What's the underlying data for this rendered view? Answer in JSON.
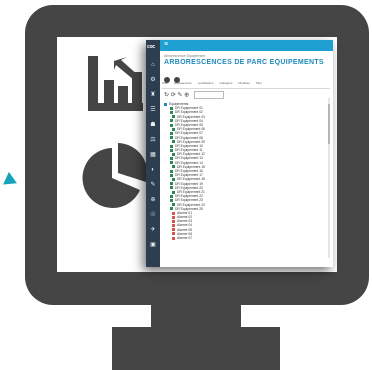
{
  "colors": {
    "monitor": "#454545",
    "accent": "#16a5b8",
    "app_header": "#1fa0d3",
    "app_sidebar": "#2c3e50"
  },
  "icons": [
    "bar-chart-growth-icon",
    "pie-chart-icon",
    "arrow-hint-icon"
  ],
  "app": {
    "logo": "coc",
    "menu_icon": "≡",
    "breadcrumb": "Arborescence Equipement",
    "title": "ARBORESCENCES DE PARC EQUIPEMENTS",
    "sidebar_icons": [
      "⌂",
      "⚙",
      "♜",
      "☰",
      "☗",
      "⚖",
      "▦",
      "◐",
      "✎",
      "⊕",
      "☉",
      "✈",
      "▣"
    ],
    "tabs": [
      "Parc",
      "Equipements",
      "Localisation",
      "Catégorie",
      "Modèles",
      "Plus"
    ],
    "toolbar_icons": "↻ ⟳ ✎ ⊕",
    "tree_rows": [
      "Equipements",
      "DR Equipement 01",
      "DR Equipement 02",
      "DR Equipement 03",
      "DR Equipement 04",
      "DR Equipement 05",
      "DR Equipement 06",
      "DR Equipement 07",
      "DR Equipement 08",
      "DR Equipement 09",
      "DR Equipement 10",
      "DR Equipement 11",
      "DR Equipement 12",
      "DR Equipement 13",
      "DR Equipement 14",
      "DR Equipement 15",
      "DR Equipement 16",
      "DR Equipement 17",
      "DR Equipement 18",
      "DR Equipement 19",
      "DR Equipement 20",
      "DR Equipement 21",
      "DR Equipement 22",
      "DR Equipement 23",
      "DR Equipement 24",
      "DR Equipement 25",
      "Alarme 01",
      "Alarme 02",
      "Alarme 03",
      "Alarme 04",
      "Alarme 05",
      "Alarme 06",
      "Alarme 07"
    ]
  }
}
